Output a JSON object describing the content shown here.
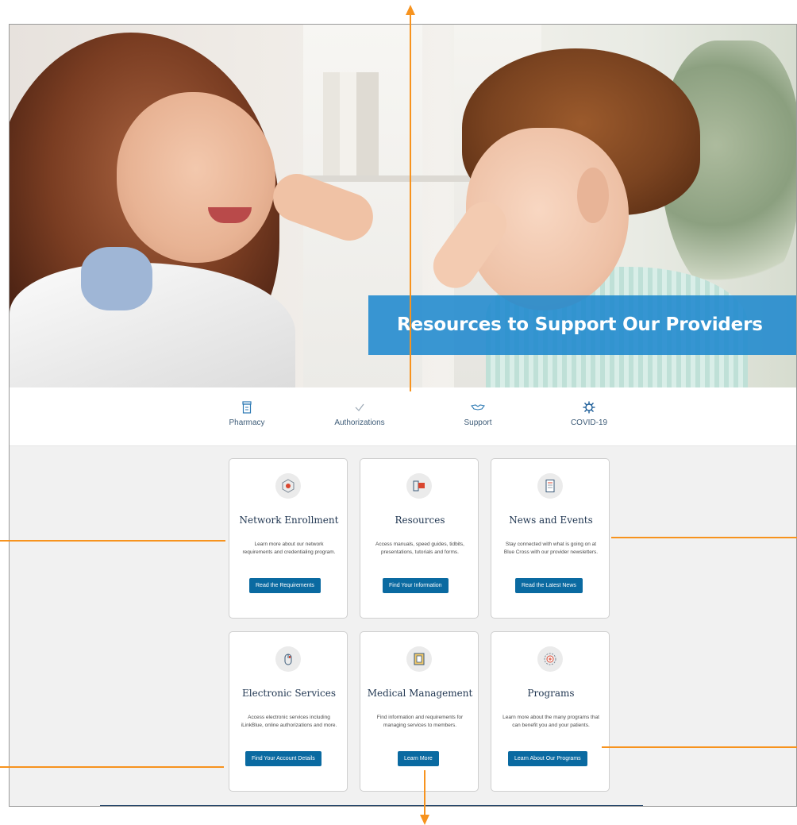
{
  "hero": {
    "banner_text": "Resources to Support Our Providers"
  },
  "quick_links": [
    {
      "label": "Pharmacy",
      "icon": "pharmacy-icon"
    },
    {
      "label": "Authorizations",
      "icon": "checkmark-icon"
    },
    {
      "label": "Support",
      "icon": "handshake-icon"
    },
    {
      "label": "COVID-19",
      "icon": "virus-icon"
    }
  ],
  "cards": [
    {
      "title": "Network Enrollment",
      "description": "Learn more about our network requirements and credentialing program.",
      "button": "Read the Requirements",
      "icon": "network-enrollment-icon"
    },
    {
      "title": "Resources",
      "description": "Access manuals, speed guides, tidbits, presentations, tutorials and forms.",
      "button": "Find Your Information",
      "icon": "resources-icon"
    },
    {
      "title": "News and Events",
      "description": "Stay connected with what is going on at Blue Cross with our provider newsletters.",
      "button": "Read the Latest News",
      "icon": "newsletter-icon"
    },
    {
      "title": "Electronic Services",
      "description": "Access electronic services including iLinkBlue, online authorizations and more.",
      "button": "Find Your Account Details",
      "icon": "mouse-icon"
    },
    {
      "title": "Medical Management",
      "description": "Find information and requirements for managing services to members.",
      "button": "Learn More",
      "icon": "clipboard-icon"
    },
    {
      "title": "Programs",
      "description": "Learn more about the many programs that can benefit you and your patients.",
      "button": "Learn About Our Programs",
      "icon": "programs-badge-icon"
    }
  ],
  "colors": {
    "banner_blue": "#1f89ce",
    "button_blue": "#0a6aa1",
    "annotation_orange": "#f7931e",
    "footer_navy": "#1c3e64"
  }
}
